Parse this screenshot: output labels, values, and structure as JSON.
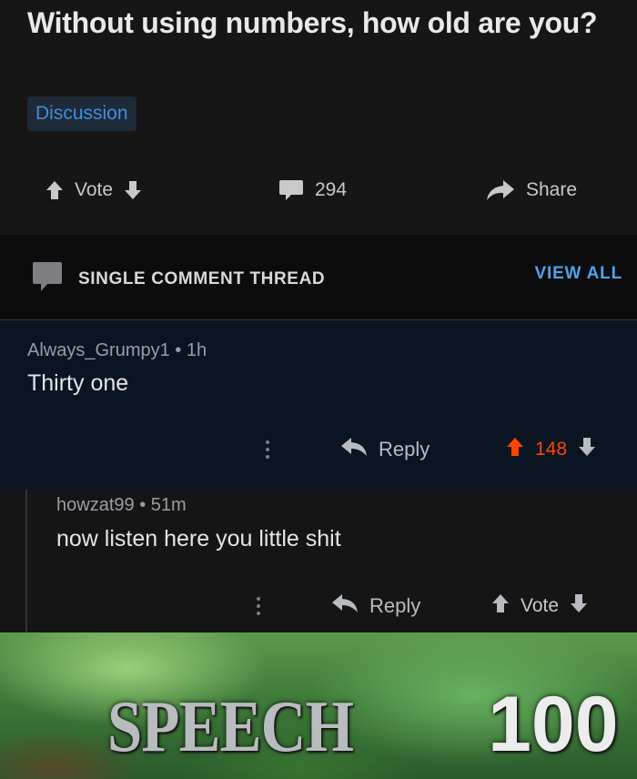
{
  "post": {
    "title": "Without using numbers, how old are you?",
    "flair": "Discussion",
    "vote_label": "Vote",
    "comment_count": "294",
    "share_label": "Share"
  },
  "thread_bar": {
    "label": "SINGLE COMMENT THREAD",
    "view_all": "VIEW ALL"
  },
  "comments": [
    {
      "author": "Always_Grumpy1",
      "time": "1h",
      "body": "Thirty one",
      "reply_label": "Reply",
      "score": "148",
      "upvoted": true
    },
    {
      "author": "howzat99",
      "time": "51m",
      "body": "now listen here you little shit",
      "reply_label": "Reply",
      "score": "Vote",
      "upvoted": false
    }
  ],
  "meme": {
    "skill": "SPEECH",
    "level": "100"
  },
  "colors": {
    "upvote_active": "#ff4500",
    "link_blue": "#4da3f0",
    "flair_blue": "#3d8fe0"
  },
  "icons": [
    "upvote-arrow-icon",
    "downvote-arrow-icon",
    "comment-bubble-icon",
    "share-arrow-icon",
    "reply-arrow-icon",
    "more-options-icon"
  ]
}
